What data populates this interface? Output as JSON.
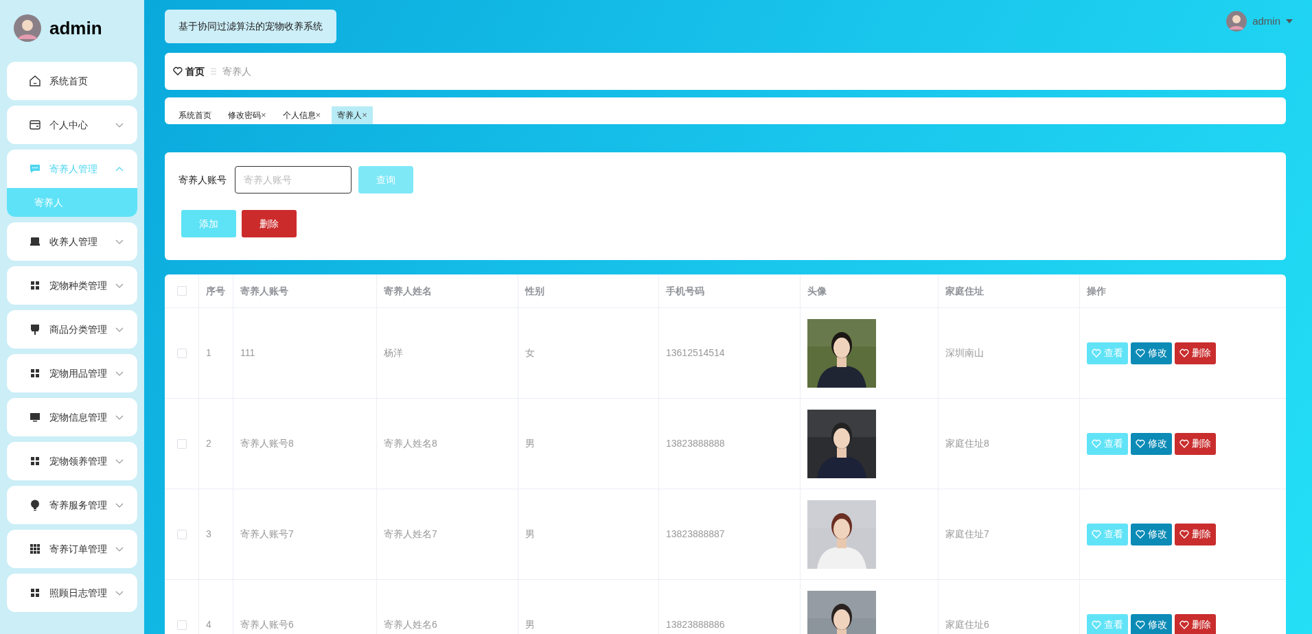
{
  "sidebar": {
    "user_name": "admin",
    "items": [
      {
        "label": "系统首页",
        "kind": "link",
        "selected": false
      },
      {
        "label": "个人中心",
        "kind": "submenu",
        "expanded": false,
        "selected": false
      },
      {
        "label": "寄养人管理",
        "kind": "submenu",
        "expanded": true,
        "selected": true,
        "children": [
          {
            "label": "寄养人",
            "selected": true
          }
        ]
      },
      {
        "label": "收养人管理",
        "kind": "submenu",
        "expanded": false,
        "selected": false
      },
      {
        "label": "宠物种类管理",
        "kind": "submenu",
        "expanded": false,
        "selected": false
      },
      {
        "label": "商品分类管理",
        "kind": "submenu",
        "expanded": false,
        "selected": false
      },
      {
        "label": "宠物用品管理",
        "kind": "submenu",
        "expanded": false,
        "selected": false
      },
      {
        "label": "宠物信息管理",
        "kind": "submenu",
        "expanded": false,
        "selected": false
      },
      {
        "label": "宠物领养管理",
        "kind": "submenu",
        "expanded": false,
        "selected": false
      },
      {
        "label": "寄养服务管理",
        "kind": "submenu",
        "expanded": false,
        "selected": false
      },
      {
        "label": "寄养订单管理",
        "kind": "submenu",
        "expanded": false,
        "selected": false
      },
      {
        "label": "照顾日志管理",
        "kind": "submenu",
        "expanded": false,
        "selected": false
      }
    ]
  },
  "header": {
    "title": "基于协同过滤算法的宠物收养系统",
    "user_name": "admin"
  },
  "breadcrumb": [
    "首页",
    "寄养人"
  ],
  "tabs": [
    {
      "label": "系统首页",
      "selected": false
    },
    {
      "label": "修改密码",
      "close": "×",
      "selected": false
    },
    {
      "label": "个人信息",
      "close": "×",
      "selected": false
    },
    {
      "label": "寄养人",
      "close": "×",
      "selected": true
    }
  ],
  "search": {
    "label": "寄养人账号",
    "placeholder": "寄养人账号",
    "button": "查询"
  },
  "actions": [
    {
      "label": "添加",
      "kind": "add"
    },
    {
      "label": "删除",
      "kind": "delete"
    }
  ],
  "table": {
    "header_checked": false,
    "columns": [
      "序号",
      "寄养人账号",
      "寄养人姓名",
      "性别",
      "手机号码",
      "头像",
      "家庭住址",
      "操作"
    ],
    "rows": [
      {
        "checked": false,
        "index": "1",
        "account": "111",
        "name": "杨洋",
        "gender": "女",
        "phone": "13612514514",
        "avatar": {
          "kind": "picture"
        },
        "address": "深圳南山",
        "actions": [
          {
            "label": "查看",
            "kind": "view"
          },
          {
            "label": "修改",
            "kind": "edit"
          },
          {
            "label": "删除",
            "kind": "delete"
          }
        ]
      },
      {
        "checked": false,
        "index": "2",
        "account": "寄养人账号8",
        "name": "寄养人姓名8",
        "gender": "男",
        "phone": "13823888888",
        "avatar": {
          "kind": "picture"
        },
        "address": "家庭住址8",
        "actions": [
          {
            "label": "查看",
            "kind": "view"
          },
          {
            "label": "修改",
            "kind": "edit"
          },
          {
            "label": "删除",
            "kind": "delete"
          }
        ]
      },
      {
        "checked": false,
        "index": "3",
        "account": "寄养人账号7",
        "name": "寄养人姓名7",
        "gender": "男",
        "phone": "13823888887",
        "avatar": {
          "kind": "picture"
        },
        "address": "家庭住址7",
        "actions": [
          {
            "label": "查看",
            "kind": "view"
          },
          {
            "label": "修改",
            "kind": "edit"
          },
          {
            "label": "删除",
            "kind": "delete"
          }
        ]
      },
      {
        "checked": false,
        "index": "4",
        "account": "寄养人账号6",
        "name": "寄养人姓名6",
        "gender": "男",
        "phone": "13823888886",
        "avatar": {
          "kind": "picture"
        },
        "address": "家庭住址6",
        "actions": [
          {
            "label": "查看",
            "kind": "view"
          },
          {
            "label": "修改",
            "kind": "edit"
          },
          {
            "label": "删除",
            "kind": "delete"
          }
        ]
      }
    ]
  }
}
